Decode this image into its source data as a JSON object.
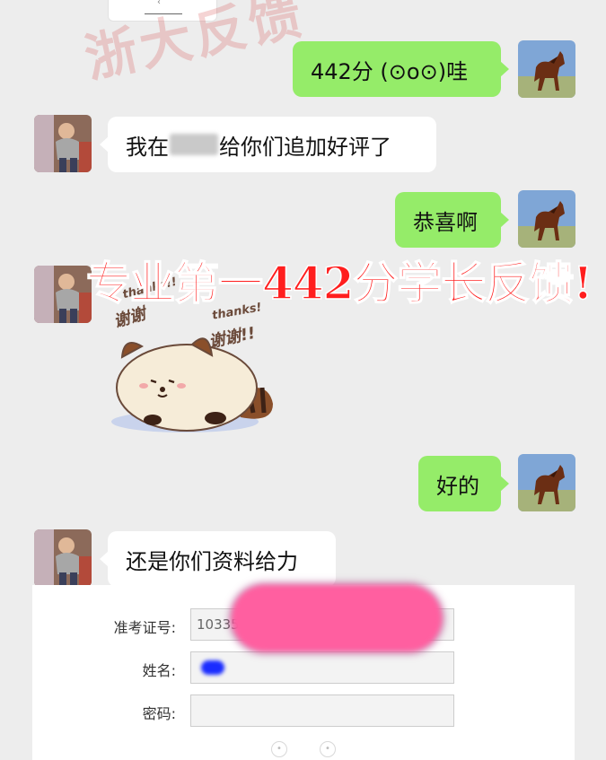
{
  "watermark": {
    "text": "浙大反馈"
  },
  "top_pill": {
    "chevron": "‹"
  },
  "messages": [
    {
      "side": "right",
      "text": "442分 (⊙o⊙)哇"
    },
    {
      "side": "left",
      "text_before": "我在",
      "text_after": "给你们追加好评了"
    },
    {
      "side": "right",
      "text": "恭喜啊"
    },
    {
      "side": "left",
      "sticker": "raccoon-thanks-sticker",
      "sticker_text": [
        "thanks!!",
        "谢谢",
        "thanks!",
        "谢谢!!"
      ]
    },
    {
      "side": "right",
      "text": "好的"
    },
    {
      "side": "left",
      "text": "还是你们资料给力"
    }
  ],
  "banner": {
    "text": "专业第一442分学长反馈!"
  },
  "form": {
    "exam_id_label": "准考证号:",
    "exam_id_value": "10335",
    "name_label": "姓名:",
    "password_label": "密码:"
  },
  "colors": {
    "background": "#ededed",
    "sent_bubble": "#95ec69",
    "received_bubble": "#ffffff",
    "banner": "#ff1e1e"
  },
  "icons": {
    "self_avatar": "horse-avatar",
    "other_avatar": "person-avatar"
  }
}
